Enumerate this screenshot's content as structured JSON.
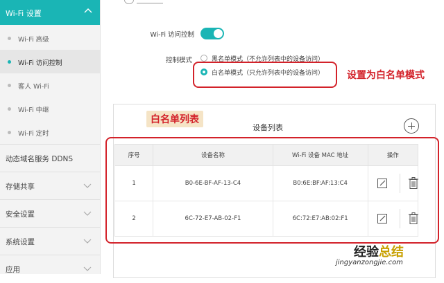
{
  "sidebar": {
    "section_title": "Wi-Fi 设置",
    "subitems": [
      {
        "label": "Wi-Fi 高级"
      },
      {
        "label": "Wi-Fi 访问控制"
      },
      {
        "label": "客人 Wi-Fi"
      },
      {
        "label": "Wi-Fi 中继"
      },
      {
        "label": "Wi-Fi 定时"
      }
    ],
    "menus": [
      {
        "label": "动态域名服务 DDNS"
      },
      {
        "label": "存储共享"
      },
      {
        "label": "安全设置"
      },
      {
        "label": "系统设置"
      },
      {
        "label": "应用"
      }
    ]
  },
  "access_control": {
    "label": "Wi-Fi 访问控制",
    "enabled": true
  },
  "control_mode": {
    "label": "控制模式",
    "options": [
      {
        "label": "黑名单模式（不允许列表中的设备访问）",
        "selected": false
      },
      {
        "label": "白名单模式（只允许列表中的设备访问）",
        "selected": true
      }
    ]
  },
  "annotations": {
    "whitelist_mode": "设置为白名单模式",
    "whitelist_list": "白名单列表"
  },
  "device_list": {
    "title": "设备列表",
    "columns": [
      "序号",
      "设备名称",
      "Wi-Fi 设备 MAC 地址",
      "操作"
    ],
    "rows": [
      {
        "index": "1",
        "name": "B0-6E-BF-AF-13-C4",
        "mac": "B0:6E:BF:AF:13:C4"
      },
      {
        "index": "2",
        "name": "6C-72-E7-AB-02-F1",
        "mac": "6C:72:E7:AB:02:F1"
      }
    ]
  },
  "watermark": {
    "text_a": "经验",
    "text_b": "总结",
    "url": "jingyanzongjie.com"
  },
  "colors": {
    "accent": "#1ab5b5",
    "annotation": "#d3222a"
  }
}
